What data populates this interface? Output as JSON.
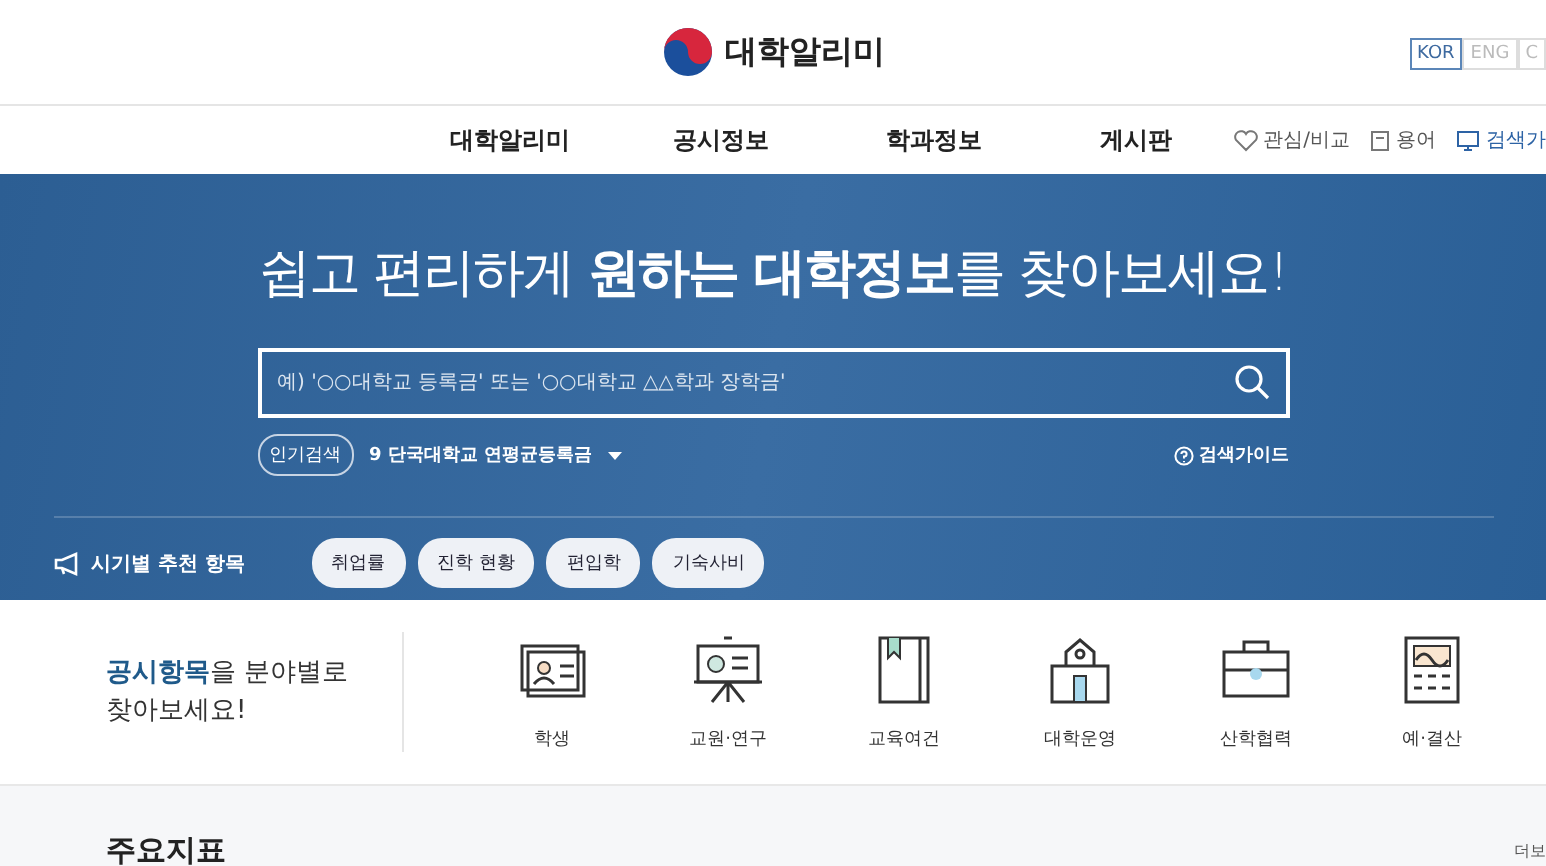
{
  "header": {
    "logo_text": "대학알리미",
    "languages": [
      {
        "label": "KOR",
        "selected": true
      },
      {
        "label": "ENG",
        "selected": false
      },
      {
        "label": "C",
        "selected": false
      }
    ]
  },
  "nav": {
    "items": [
      "대학알리미",
      "공시정보",
      "학과정보",
      "게시판"
    ],
    "utilities": [
      {
        "kind": "heart",
        "label": "관심/비교"
      },
      {
        "kind": "book",
        "label": "용어"
      },
      {
        "kind": "monitor",
        "label": "검색가"
      }
    ]
  },
  "hero": {
    "headline": "쉽고 편리하게 **원하는 대학정보**를 찾아보세요!",
    "search": {
      "placeholder": "예) '○○대학교 등록금' 또는 '○○대학교 △△학과 장학금'"
    },
    "popular_label": "인기검색",
    "popular_item": "9 단국대학교 연평균등록금",
    "guide": "검색가이드",
    "recommend_label": "시기별 추천 항목",
    "chips": [
      "취업률",
      "진학 현황",
      "편입학",
      "기숙사비"
    ]
  },
  "categories": {
    "intro": "**공시항목**을 분야별로",
    "intro_line2": "찾아보세요!",
    "items": [
      {
        "kind": "student",
        "label": "학생"
      },
      {
        "kind": "faculty",
        "label": "교원·연구"
      },
      {
        "kind": "education",
        "label": "교육여건"
      },
      {
        "kind": "operation",
        "label": "대학운영"
      },
      {
        "kind": "industry",
        "label": "산학협력"
      },
      {
        "kind": "budget",
        "label": "예·결산"
      }
    ]
  },
  "indicators": {
    "title": "주요지표",
    "more": "더보"
  }
}
